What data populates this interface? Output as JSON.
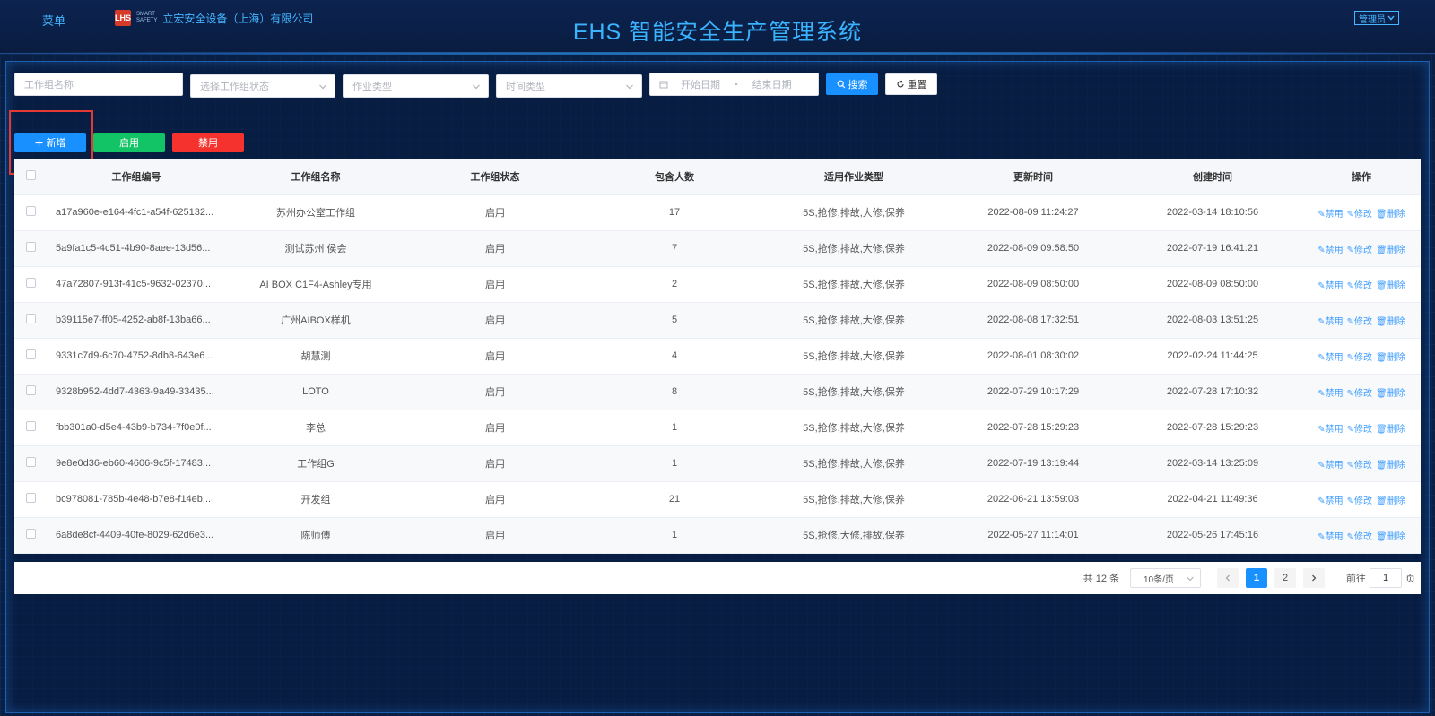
{
  "header": {
    "menu_label": "菜单",
    "logo_text": "LHS",
    "logo_sub_top": "SMART",
    "logo_sub_mid": "SAFETY",
    "company_name": "立宏安全设备（上海）有限公司",
    "system_title": "EHS 智能安全生产管理系统",
    "user_label": "管理员"
  },
  "filters": {
    "name_placeholder": "工作组名称",
    "status_placeholder": "选择工作组状态",
    "work_type_placeholder": "作业类型",
    "time_type_placeholder": "时间类型",
    "start_date_placeholder": "开始日期",
    "date_separator": "-",
    "end_date_placeholder": "结束日期",
    "search_label": "搜索",
    "reset_label": "重置"
  },
  "actions": {
    "add_label": "新增",
    "enable_label": "启用",
    "disable_label": "禁用",
    "colors": {
      "add": "#1890ff",
      "enable": "#13c466",
      "disable": "#f5322d"
    }
  },
  "table": {
    "columns": [
      "工作组编号",
      "工作组名称",
      "工作组状态",
      "包含人数",
      "适用作业类型",
      "更新时间",
      "创建时间",
      "操作"
    ],
    "op_labels": {
      "disable": "禁用",
      "edit": "修改",
      "delete": "删除"
    },
    "rows": [
      {
        "id": "a17a960e-e164-4fc1-a54f-625132...",
        "name": "苏州办公室工作组",
        "status": "启用",
        "count": "17",
        "types": "5S,抢修,排故,大修,保养",
        "updated": "2022-08-09 11:24:27",
        "created": "2022-03-14 18:10:56"
      },
      {
        "id": "5a9fa1c5-4c51-4b90-8aee-13d56...",
        "name": "测试苏州 侯会",
        "status": "启用",
        "count": "7",
        "types": "5S,抢修,排故,大修,保养",
        "updated": "2022-08-09 09:58:50",
        "created": "2022-07-19 16:41:21"
      },
      {
        "id": "47a72807-913f-41c5-9632-02370...",
        "name": "AI BOX C1F4-Ashley专用",
        "status": "启用",
        "count": "2",
        "types": "5S,抢修,排故,大修,保养",
        "updated": "2022-08-09 08:50:00",
        "created": "2022-08-09 08:50:00"
      },
      {
        "id": "b39115e7-ff05-4252-ab8f-13ba66...",
        "name": "广州AIBOX样机",
        "status": "启用",
        "count": "5",
        "types": "5S,抢修,排故,大修,保养",
        "updated": "2022-08-08 17:32:51",
        "created": "2022-08-03 13:51:25"
      },
      {
        "id": "9331c7d9-6c70-4752-8db8-643e6...",
        "name": "胡慧测",
        "status": "启用",
        "count": "4",
        "types": "5S,抢修,排故,大修,保养",
        "updated": "2022-08-01 08:30:02",
        "created": "2022-02-24 11:44:25"
      },
      {
        "id": "9328b952-4dd7-4363-9a49-33435...",
        "name": "LOTO",
        "status": "启用",
        "count": "8",
        "types": "5S,抢修,排故,大修,保养",
        "updated": "2022-07-29 10:17:29",
        "created": "2022-07-28 17:10:32"
      },
      {
        "id": "fbb301a0-d5e4-43b9-b734-7f0e0f...",
        "name": "李总",
        "status": "启用",
        "count": "1",
        "types": "5S,抢修,排故,大修,保养",
        "updated": "2022-07-28 15:29:23",
        "created": "2022-07-28 15:29:23"
      },
      {
        "id": "9e8e0d36-eb60-4606-9c5f-17483...",
        "name": "工作组G",
        "status": "启用",
        "count": "1",
        "types": "5S,抢修,排故,大修,保养",
        "updated": "2022-07-19 13:19:44",
        "created": "2022-03-14 13:25:09"
      },
      {
        "id": "bc978081-785b-4e48-b7e8-f14eb...",
        "name": "开发组",
        "status": "启用",
        "count": "21",
        "types": "5S,抢修,排故,大修,保养",
        "updated": "2022-06-21 13:59:03",
        "created": "2022-04-21 11:49:36"
      },
      {
        "id": "6a8de8cf-4409-40fe-8029-62d6e3...",
        "name": "陈师傅",
        "status": "启用",
        "count": "1",
        "types": "5S,抢修,大修,排故,保养",
        "updated": "2022-05-27 11:14:01",
        "created": "2022-05-26 17:45:16"
      }
    ]
  },
  "pagination": {
    "total_text": "共 12 条",
    "page_size": "10条/页",
    "pages": [
      "1",
      "2"
    ],
    "current_page": "1",
    "goto_label": "前往",
    "goto_value": "1",
    "page_suffix": "页"
  }
}
